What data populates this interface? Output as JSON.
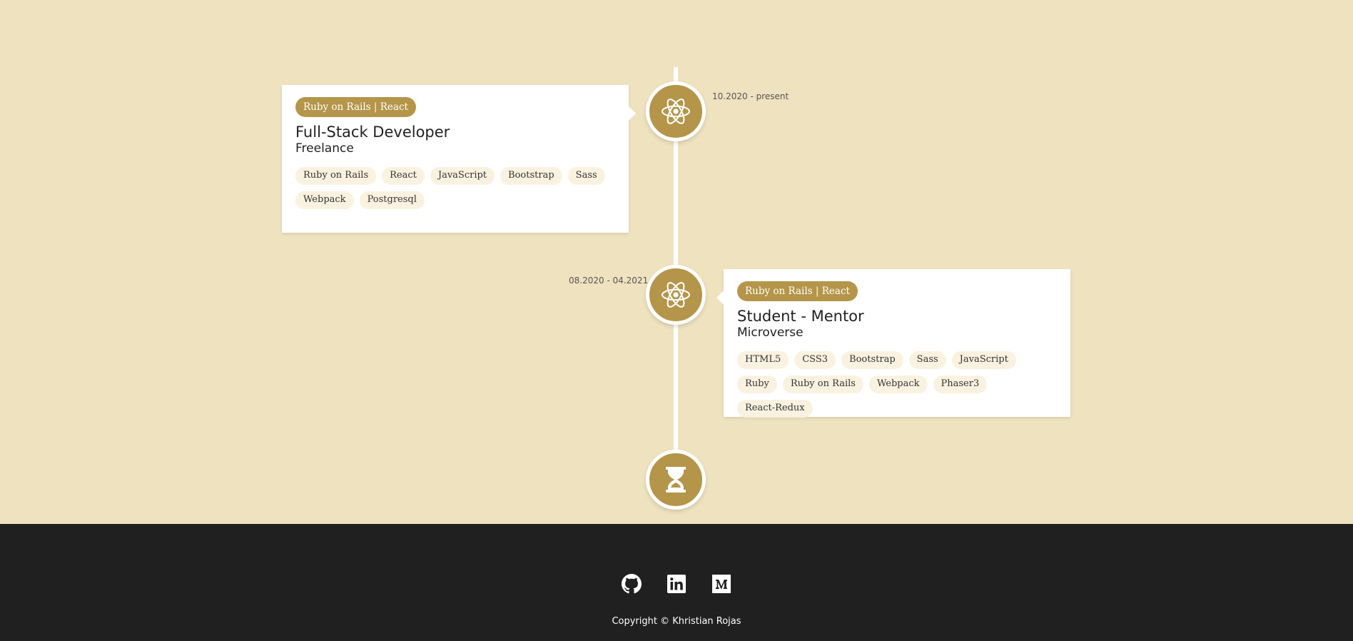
{
  "timeline": {
    "items": [
      {
        "date": "10.2020 - present",
        "category": "Ruby on Rails | React",
        "title": "Full-Stack Developer",
        "company": "Freelance",
        "icon": "react-icon",
        "tags": [
          "Ruby on Rails",
          "React",
          "JavaScript",
          "Bootstrap",
          "Sass",
          "Webpack",
          "Postgresql"
        ]
      },
      {
        "date": "08.2020 - 04.2021",
        "category": "Ruby on Rails | React",
        "title": "Student - Mentor",
        "company": "Microverse",
        "icon": "react-icon",
        "tags": [
          "HTML5",
          "CSS3",
          "Bootstrap",
          "Sass",
          "JavaScript",
          "Ruby",
          "Ruby on Rails",
          "Webpack",
          "Phaser3",
          "React-Redux"
        ]
      }
    ],
    "end_icon": "hourglass-icon"
  },
  "footer": {
    "social": [
      {
        "name": "github-icon"
      },
      {
        "name": "linkedin-icon"
      },
      {
        "name": "medium-icon"
      }
    ],
    "copyright": "Copyright © Khristian Rojas"
  },
  "colors": {
    "background": "#efe2bf",
    "accent": "#b49549",
    "tag_background": "#faf2e0",
    "footer": "#202020"
  }
}
